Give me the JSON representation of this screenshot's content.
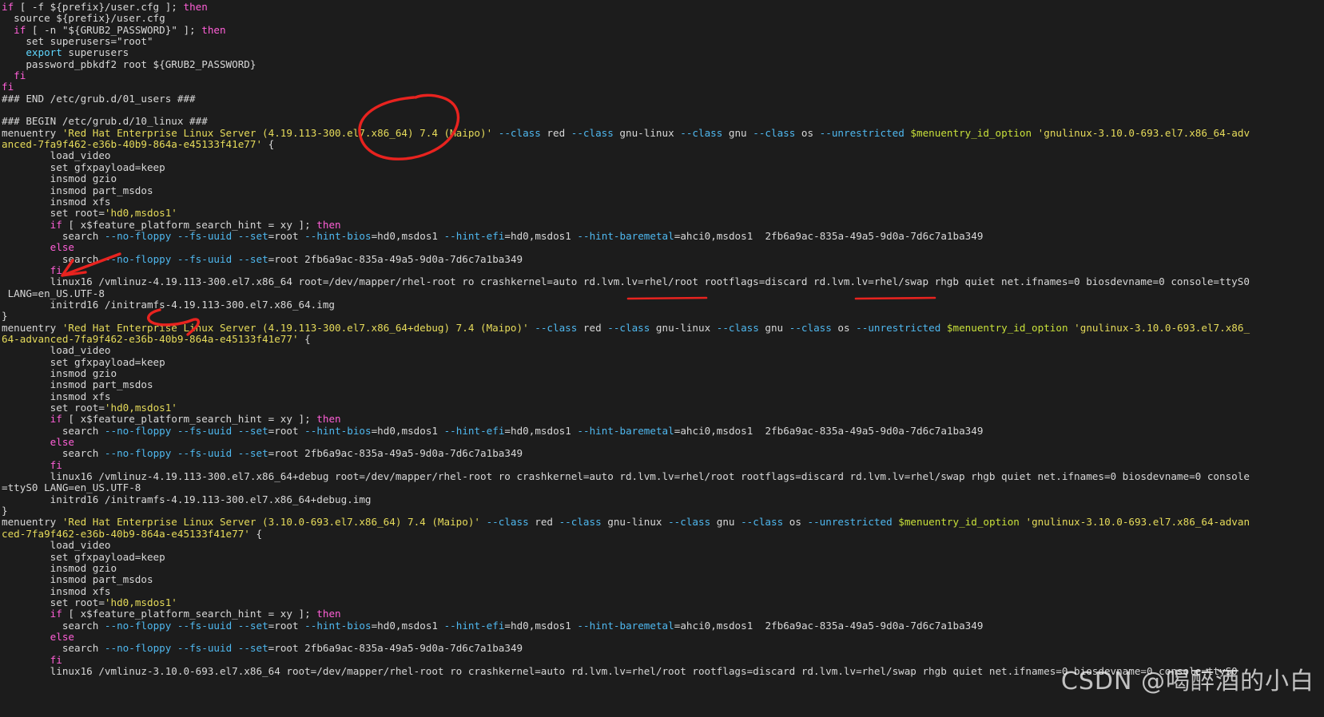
{
  "window": {
    "kind": "terminal-text-viewer",
    "background_color": "#1c1c1c",
    "foreground_color": "#d8d8d8",
    "font": "monospace"
  },
  "palette": {
    "keyword_magenta": "#ff5fd7",
    "builtin_cyan": "#5fd7ff",
    "option_blue": "#4fb8ef",
    "string_yellow": "#e6db5a",
    "variable_green": "#c8e03a",
    "plain": "#d8d8d8",
    "annotation_red": "#e8231f",
    "watermark": "rgba(235,235,235,0.80)"
  },
  "watermark": {
    "text": "CSDN @喝醉酒的小白"
  },
  "annotations": [
    {
      "name": "red-ellipse-kernel-version",
      "shape": "ellipse",
      "target": "el7.x86_64) 7.4"
    },
    {
      "name": "red-arrow-to-fi",
      "shape": "arrow",
      "target": "fi"
    },
    {
      "name": "red-underline-rd-lvm-lv-rhel-root",
      "shape": "underline",
      "target": "rd.lvm.lv=rhel/root"
    },
    {
      "name": "red-underline-rd-lvm-lv-rhel-swap",
      "shape": "underline",
      "target": "rd.lvm.lv=rhel/swap"
    },
    {
      "name": "red-squiggle-initramfs",
      "shape": "squiggle",
      "target": "/initramfs-4.19.113-300.el7.x86_64.img"
    }
  ],
  "lines": [
    [
      {
        "t": "if",
        "c": "kw"
      },
      {
        "t": " [ -f ${prefix}/user.cfg ]; ",
        "c": "plain"
      },
      {
        "t": "then",
        "c": "kw"
      }
    ],
    [
      {
        "t": "  source ${prefix}/user.cfg",
        "c": "plain"
      }
    ],
    [
      {
        "t": "  ",
        "c": "plain"
      },
      {
        "t": "if",
        "c": "kw"
      },
      {
        "t": " [ -n \"${GRUB2_PASSWORD}\" ]; ",
        "c": "plain"
      },
      {
        "t": "then",
        "c": "kw"
      }
    ],
    [
      {
        "t": "    set superusers=\"root\"",
        "c": "plain"
      }
    ],
    [
      {
        "t": "    ",
        "c": "plain"
      },
      {
        "t": "export",
        "c": "bi"
      },
      {
        "t": " superusers",
        "c": "plain"
      }
    ],
    [
      {
        "t": "    password_pbkdf2 root ${GRUB2_PASSWORD}",
        "c": "plain"
      }
    ],
    [
      {
        "t": "  ",
        "c": "plain"
      },
      {
        "t": "fi",
        "c": "kw"
      }
    ],
    [
      {
        "t": "fi",
        "c": "kw"
      }
    ],
    [
      {
        "t": "### END /etc/grub.d/01_users ###",
        "c": "plain"
      }
    ],
    [
      {
        "t": "",
        "c": "plain"
      }
    ],
    [
      {
        "t": "### BEGIN /etc/grub.d/10_linux ###",
        "c": "plain"
      }
    ],
    [
      {
        "t": "menuentry ",
        "c": "plain"
      },
      {
        "t": "'Red Hat Enterprise Linux Server (4.19.113-300.el7.x86_64) 7.4 (Maipo)'",
        "c": "str"
      },
      {
        "t": " ",
        "c": "plain"
      },
      {
        "t": "--class",
        "c": "opt"
      },
      {
        "t": " red ",
        "c": "plain"
      },
      {
        "t": "--class",
        "c": "opt"
      },
      {
        "t": " gnu-linux ",
        "c": "plain"
      },
      {
        "t": "--class",
        "c": "opt"
      },
      {
        "t": " gnu ",
        "c": "plain"
      },
      {
        "t": "--class",
        "c": "opt"
      },
      {
        "t": " os ",
        "c": "plain"
      },
      {
        "t": "--unrestricted",
        "c": "opt"
      },
      {
        "t": " ",
        "c": "plain"
      },
      {
        "t": "$menuentry_id_option",
        "c": "var"
      },
      {
        "t": " ",
        "c": "plain"
      },
      {
        "t": "'gnulinux-3.10.0-693.el7.x86_64-adv",
        "c": "str"
      }
    ],
    [
      {
        "t": "anced-7fa9f462-e36b-40b9-864a-e45133f41e77'",
        "c": "str"
      },
      {
        "t": " {",
        "c": "plain"
      }
    ],
    [
      {
        "t": "        load_video",
        "c": "plain"
      }
    ],
    [
      {
        "t": "        set gfxpayload=keep",
        "c": "plain"
      }
    ],
    [
      {
        "t": "        insmod gzio",
        "c": "plain"
      }
    ],
    [
      {
        "t": "        insmod part_msdos",
        "c": "plain"
      }
    ],
    [
      {
        "t": "        insmod xfs",
        "c": "plain"
      }
    ],
    [
      {
        "t": "        set root=",
        "c": "plain"
      },
      {
        "t": "'hd0,msdos1'",
        "c": "str"
      }
    ],
    [
      {
        "t": "        ",
        "c": "plain"
      },
      {
        "t": "if",
        "c": "kw"
      },
      {
        "t": " [ x$feature_platform_search_hint = xy ]; ",
        "c": "plain"
      },
      {
        "t": "then",
        "c": "kw"
      }
    ],
    [
      {
        "t": "          search ",
        "c": "plain"
      },
      {
        "t": "--no-floppy",
        "c": "opt"
      },
      {
        "t": " ",
        "c": "plain"
      },
      {
        "t": "--fs-uuid",
        "c": "opt"
      },
      {
        "t": " ",
        "c": "plain"
      },
      {
        "t": "--set",
        "c": "opt"
      },
      {
        "t": "=root ",
        "c": "plain"
      },
      {
        "t": "--hint-bios",
        "c": "opt"
      },
      {
        "t": "=hd0,msdos1 ",
        "c": "plain"
      },
      {
        "t": "--hint-efi",
        "c": "opt"
      },
      {
        "t": "=hd0,msdos1 ",
        "c": "plain"
      },
      {
        "t": "--hint-baremetal",
        "c": "opt"
      },
      {
        "t": "=ahci0,msdos1  2fb6a9ac-835a-49a5-9d0a-7d6c7a1ba349",
        "c": "plain"
      }
    ],
    [
      {
        "t": "        ",
        "c": "plain"
      },
      {
        "t": "else",
        "c": "kw"
      }
    ],
    [
      {
        "t": "          search ",
        "c": "plain"
      },
      {
        "t": "--no-floppy",
        "c": "opt"
      },
      {
        "t": " ",
        "c": "plain"
      },
      {
        "t": "--fs-uuid",
        "c": "opt"
      },
      {
        "t": " ",
        "c": "plain"
      },
      {
        "t": "--set",
        "c": "opt"
      },
      {
        "t": "=root 2fb6a9ac-835a-49a5-9d0a-7d6c7a1ba349",
        "c": "plain"
      }
    ],
    [
      {
        "t": "        ",
        "c": "plain"
      },
      {
        "t": "fi",
        "c": "kw"
      }
    ],
    [
      {
        "t": "        linux16 /vmlinuz-4.19.113-300.el7.x86_64 root=/dev/mapper/rhel-root ro crashkernel=auto rd.lvm.lv=rhel/root rootflags=discard rd.lvm.lv=rhel/swap rhgb quiet net.ifnames=0 biosdevname=0 console=ttyS0",
        "c": "plain"
      }
    ],
    [
      {
        "t": " LANG=en_US.UTF-8",
        "c": "plain"
      }
    ],
    [
      {
        "t": "        initrd16 /initramfs-4.19.113-300.el7.x86_64.img",
        "c": "plain"
      }
    ],
    [
      {
        "t": "}",
        "c": "plain"
      }
    ],
    [
      {
        "t": "menuentry ",
        "c": "plain"
      },
      {
        "t": "'Red Hat Enterprise Linux Server (4.19.113-300.el7.x86_64+debug) 7.4 (Maipo)'",
        "c": "str"
      },
      {
        "t": " ",
        "c": "plain"
      },
      {
        "t": "--class",
        "c": "opt"
      },
      {
        "t": " red ",
        "c": "plain"
      },
      {
        "t": "--class",
        "c": "opt"
      },
      {
        "t": " gnu-linux ",
        "c": "plain"
      },
      {
        "t": "--class",
        "c": "opt"
      },
      {
        "t": " gnu ",
        "c": "plain"
      },
      {
        "t": "--class",
        "c": "opt"
      },
      {
        "t": " os ",
        "c": "plain"
      },
      {
        "t": "--unrestricted",
        "c": "opt"
      },
      {
        "t": " ",
        "c": "plain"
      },
      {
        "t": "$menuentry_id_option",
        "c": "var"
      },
      {
        "t": " ",
        "c": "plain"
      },
      {
        "t": "'gnulinux-3.10.0-693.el7.x86_",
        "c": "str"
      }
    ],
    [
      {
        "t": "64-advanced-7fa9f462-e36b-40b9-864a-e45133f41e77'",
        "c": "str"
      },
      {
        "t": " {",
        "c": "plain"
      }
    ],
    [
      {
        "t": "        load_video",
        "c": "plain"
      }
    ],
    [
      {
        "t": "        set gfxpayload=keep",
        "c": "plain"
      }
    ],
    [
      {
        "t": "        insmod gzio",
        "c": "plain"
      }
    ],
    [
      {
        "t": "        insmod part_msdos",
        "c": "plain"
      }
    ],
    [
      {
        "t": "        insmod xfs",
        "c": "plain"
      }
    ],
    [
      {
        "t": "        set root=",
        "c": "plain"
      },
      {
        "t": "'hd0,msdos1'",
        "c": "str"
      }
    ],
    [
      {
        "t": "        ",
        "c": "plain"
      },
      {
        "t": "if",
        "c": "kw"
      },
      {
        "t": " [ x$feature_platform_search_hint = xy ]; ",
        "c": "plain"
      },
      {
        "t": "then",
        "c": "kw"
      }
    ],
    [
      {
        "t": "          search ",
        "c": "plain"
      },
      {
        "t": "--no-floppy",
        "c": "opt"
      },
      {
        "t": " ",
        "c": "plain"
      },
      {
        "t": "--fs-uuid",
        "c": "opt"
      },
      {
        "t": " ",
        "c": "plain"
      },
      {
        "t": "--set",
        "c": "opt"
      },
      {
        "t": "=root ",
        "c": "plain"
      },
      {
        "t": "--hint-bios",
        "c": "opt"
      },
      {
        "t": "=hd0,msdos1 ",
        "c": "plain"
      },
      {
        "t": "--hint-efi",
        "c": "opt"
      },
      {
        "t": "=hd0,msdos1 ",
        "c": "plain"
      },
      {
        "t": "--hint-baremetal",
        "c": "opt"
      },
      {
        "t": "=ahci0,msdos1  2fb6a9ac-835a-49a5-9d0a-7d6c7a1ba349",
        "c": "plain"
      }
    ],
    [
      {
        "t": "        ",
        "c": "plain"
      },
      {
        "t": "else",
        "c": "kw"
      }
    ],
    [
      {
        "t": "          search ",
        "c": "plain"
      },
      {
        "t": "--no-floppy",
        "c": "opt"
      },
      {
        "t": " ",
        "c": "plain"
      },
      {
        "t": "--fs-uuid",
        "c": "opt"
      },
      {
        "t": " ",
        "c": "plain"
      },
      {
        "t": "--set",
        "c": "opt"
      },
      {
        "t": "=root 2fb6a9ac-835a-49a5-9d0a-7d6c7a1ba349",
        "c": "plain"
      }
    ],
    [
      {
        "t": "        ",
        "c": "plain"
      },
      {
        "t": "fi",
        "c": "kw"
      }
    ],
    [
      {
        "t": "        linux16 /vmlinuz-4.19.113-300.el7.x86_64+debug root=/dev/mapper/rhel-root ro crashkernel=auto rd.lvm.lv=rhel/root rootflags=discard rd.lvm.lv=rhel/swap rhgb quiet net.ifnames=0 biosdevname=0 console",
        "c": "plain"
      }
    ],
    [
      {
        "t": "=ttyS0 LANG=en_US.UTF-8",
        "c": "plain"
      }
    ],
    [
      {
        "t": "        initrd16 /initramfs-4.19.113-300.el7.x86_64+debug.img",
        "c": "plain"
      }
    ],
    [
      {
        "t": "}",
        "c": "plain"
      }
    ],
    [
      {
        "t": "menuentry ",
        "c": "plain"
      },
      {
        "t": "'Red Hat Enterprise Linux Server (3.10.0-693.el7.x86_64) 7.4 (Maipo)'",
        "c": "str"
      },
      {
        "t": " ",
        "c": "plain"
      },
      {
        "t": "--class",
        "c": "opt"
      },
      {
        "t": " red ",
        "c": "plain"
      },
      {
        "t": "--class",
        "c": "opt"
      },
      {
        "t": " gnu-linux ",
        "c": "plain"
      },
      {
        "t": "--class",
        "c": "opt"
      },
      {
        "t": " gnu ",
        "c": "plain"
      },
      {
        "t": "--class",
        "c": "opt"
      },
      {
        "t": " os ",
        "c": "plain"
      },
      {
        "t": "--unrestricted",
        "c": "opt"
      },
      {
        "t": " ",
        "c": "plain"
      },
      {
        "t": "$menuentry_id_option",
        "c": "var"
      },
      {
        "t": " ",
        "c": "plain"
      },
      {
        "t": "'gnulinux-3.10.0-693.el7.x86_64-advan",
        "c": "str"
      }
    ],
    [
      {
        "t": "ced-7fa9f462-e36b-40b9-864a-e45133f41e77'",
        "c": "str"
      },
      {
        "t": " {",
        "c": "plain"
      }
    ],
    [
      {
        "t": "        load_video",
        "c": "plain"
      }
    ],
    [
      {
        "t": "        set gfxpayload=keep",
        "c": "plain"
      }
    ],
    [
      {
        "t": "        insmod gzio",
        "c": "plain"
      }
    ],
    [
      {
        "t": "        insmod part_msdos",
        "c": "plain"
      }
    ],
    [
      {
        "t": "        insmod xfs",
        "c": "plain"
      }
    ],
    [
      {
        "t": "        set root=",
        "c": "plain"
      },
      {
        "t": "'hd0,msdos1'",
        "c": "str"
      }
    ],
    [
      {
        "t": "        ",
        "c": "plain"
      },
      {
        "t": "if",
        "c": "kw"
      },
      {
        "t": " [ x$feature_platform_search_hint = xy ]; ",
        "c": "plain"
      },
      {
        "t": "then",
        "c": "kw"
      }
    ],
    [
      {
        "t": "          search ",
        "c": "plain"
      },
      {
        "t": "--no-floppy",
        "c": "opt"
      },
      {
        "t": " ",
        "c": "plain"
      },
      {
        "t": "--fs-uuid",
        "c": "opt"
      },
      {
        "t": " ",
        "c": "plain"
      },
      {
        "t": "--set",
        "c": "opt"
      },
      {
        "t": "=root ",
        "c": "plain"
      },
      {
        "t": "--hint-bios",
        "c": "opt"
      },
      {
        "t": "=hd0,msdos1 ",
        "c": "plain"
      },
      {
        "t": "--hint-efi",
        "c": "opt"
      },
      {
        "t": "=hd0,msdos1 ",
        "c": "plain"
      },
      {
        "t": "--hint-baremetal",
        "c": "opt"
      },
      {
        "t": "=ahci0,msdos1  2fb6a9ac-835a-49a5-9d0a-7d6c7a1ba349",
        "c": "plain"
      }
    ],
    [
      {
        "t": "        ",
        "c": "plain"
      },
      {
        "t": "else",
        "c": "kw"
      }
    ],
    [
      {
        "t": "          search ",
        "c": "plain"
      },
      {
        "t": "--no-floppy",
        "c": "opt"
      },
      {
        "t": " ",
        "c": "plain"
      },
      {
        "t": "--fs-uuid",
        "c": "opt"
      },
      {
        "t": " ",
        "c": "plain"
      },
      {
        "t": "--set",
        "c": "opt"
      },
      {
        "t": "=root 2fb6a9ac-835a-49a5-9d0a-7d6c7a1ba349",
        "c": "plain"
      }
    ],
    [
      {
        "t": "        ",
        "c": "plain"
      },
      {
        "t": "fi",
        "c": "kw"
      }
    ],
    [
      {
        "t": "        linux16 /vmlinuz-3.10.0-693.el7.x86_64 root=/dev/mapper/rhel-root ro crashkernel=auto rd.lvm.lv=rhel/root rootflags=discard rd.lvm.lv=rhel/swap rhgb quiet net.ifnames=0 biosdevname=0 console=ttyS0",
        "c": "plain"
      }
    ]
  ]
}
